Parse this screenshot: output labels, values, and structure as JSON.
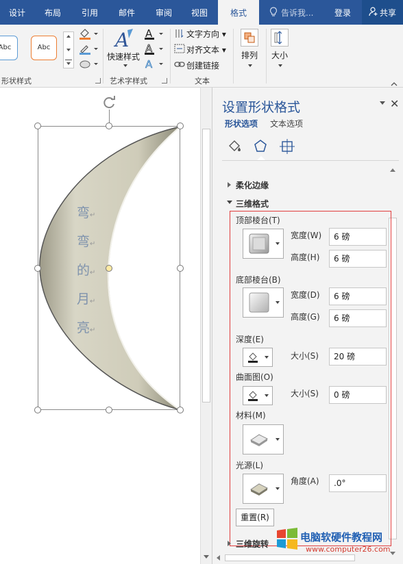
{
  "tabs": [
    "设计",
    "布局",
    "引用",
    "邮件",
    "审阅",
    "视图",
    "格式"
  ],
  "tell_me": "告诉我...",
  "login": "登录",
  "share": "共享",
  "ribbon": {
    "abc1": "Abc",
    "abc2": "Abc",
    "shape_styles_label": "形状样式",
    "quick_styles": "快速样式",
    "wordart_label": "艺术字样式",
    "text_direction": "文字方向",
    "align_text": "对齐文本",
    "create_link": "创建链接",
    "text_label": "文本",
    "arrange": "排列",
    "size": "大小"
  },
  "document": {
    "chars": [
      "弯",
      "弯",
      "的",
      "月",
      "亮"
    ]
  },
  "pane": {
    "title": "设置形状格式",
    "tab_shape": "形状选项",
    "tab_text": "文本选项",
    "soft_edges": "柔化边缘",
    "three_d": "三维格式",
    "top_bevel": "顶部棱台(T)",
    "width_label": "宽度(W)",
    "width_value": "6 磅",
    "height_label": "高度(H)",
    "height_value": "6 磅",
    "bottom_bevel": "底部棱台(B)",
    "width2_label": "宽度(D)",
    "width2_value": "6 磅",
    "height2_label": "高度(G)",
    "height2_value": "6 磅",
    "depth": "深度(E)",
    "depth_size_label": "大小(S)",
    "depth_size_value": "20 磅",
    "contour": "曲面图(O)",
    "contour_size_label": "大小(S)",
    "contour_size_value": "0 磅",
    "material": "材料(M)",
    "lighting": "光源(L)",
    "angle_label": "角度(A)",
    "angle_value": ".0°",
    "reset": "重置(R)",
    "three_d_rotation": "三维旋转"
  },
  "watermark": {
    "title": "电脑软硬件教程网",
    "url": "www.computer26.com"
  },
  "colors": {
    "accent": "#2b579a",
    "highlight_border": "#e03c3c",
    "moon_fill": "#c9c6b3",
    "doc_text": "#7f93ad"
  }
}
